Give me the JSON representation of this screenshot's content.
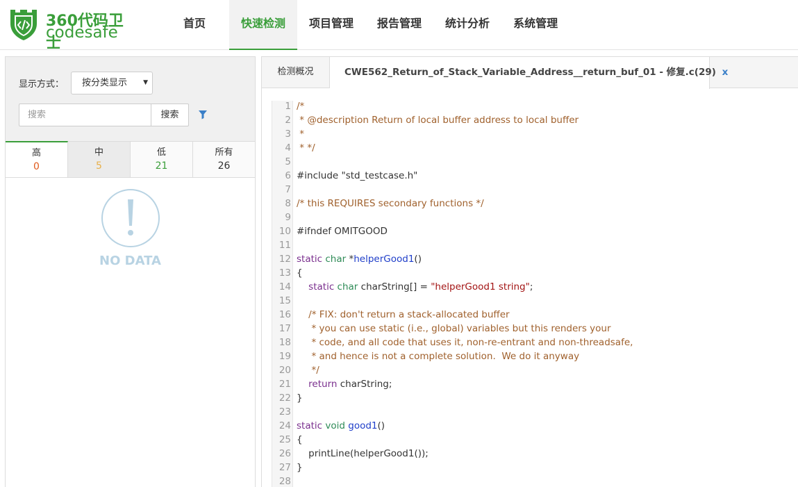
{
  "app": {
    "logo_cn": "360代码卫士",
    "logo_en": "codesafe",
    "colors": {
      "brand_green": "#3a9e3a",
      "link_blue": "#3a7fc8",
      "high": "#e05a1c",
      "medium": "#e8b04a",
      "low": "#3a9e3a"
    }
  },
  "nav": {
    "items": [
      {
        "label": "首页"
      },
      {
        "label": "快速检测"
      },
      {
        "label": "项目管理"
      },
      {
        "label": "报告管理"
      },
      {
        "label": "统计分析"
      },
      {
        "label": "系统管理"
      }
    ],
    "active": "快速检测"
  },
  "sidebar": {
    "display_label": "显示方式：",
    "display_value": "按分类显示",
    "search_placeholder": "搜索",
    "search_button": "搜索",
    "filter_icon": "filter-icon",
    "severity_tabs": [
      {
        "name": "高",
        "count": "0",
        "color": "#e05a1c"
      },
      {
        "name": "中",
        "count": "5",
        "color": "#e8b04a"
      },
      {
        "name": "低",
        "count": "21",
        "color": "#3a9e3a"
      },
      {
        "name": "所有",
        "count": "26",
        "color": "#333333"
      }
    ],
    "empty_icon": "exclamation-circle-icon",
    "empty_text": "NO DATA"
  },
  "tabs": {
    "overview_label": "检测概况",
    "file_label": "CWE562_Return_of_Stack_Variable_Address__return_buf_01 - 修复.c(29)",
    "close_label": "x"
  },
  "code": {
    "lines": [
      {
        "n": "1",
        "text": "/*",
        "kind": "comment"
      },
      {
        "n": "2",
        "text": " * @description Return of local buffer address to local buffer",
        "kind": "comment"
      },
      {
        "n": "3",
        "text": " *",
        "kind": "comment"
      },
      {
        "n": "4",
        "text": " * */",
        "kind": "comment"
      },
      {
        "n": "5",
        "text": "",
        "kind": "plain"
      },
      {
        "n": "6",
        "text": "#include \"std_testcase.h\"",
        "kind": "plain"
      },
      {
        "n": "7",
        "text": "",
        "kind": "plain"
      },
      {
        "n": "8",
        "text": "/* this REQUIRES secondary functions */",
        "kind": "comment"
      },
      {
        "n": "9",
        "text": "",
        "kind": "plain"
      },
      {
        "n": "10",
        "text": "#ifndef OMITGOOD",
        "kind": "plain"
      },
      {
        "n": "11",
        "text": "",
        "kind": "plain"
      },
      {
        "n": "12",
        "text": "static char *helperGood1()",
        "kind": "sig1"
      },
      {
        "n": "13",
        "text": "{",
        "kind": "plain"
      },
      {
        "n": "14",
        "text": "    static char charString[] = \"helperGood1 string\";",
        "kind": "decl"
      },
      {
        "n": "15",
        "text": "",
        "kind": "plain"
      },
      {
        "n": "16",
        "text": "    /* FIX: don't return a stack-allocated buffer",
        "kind": "comment"
      },
      {
        "n": "17",
        "text": "     * you can use static (i.e., global) variables but this renders your",
        "kind": "comment"
      },
      {
        "n": "18",
        "text": "     * code, and all code that uses it, non-re-entrant and non-threadsafe,",
        "kind": "comment"
      },
      {
        "n": "19",
        "text": "     * and hence is not a complete solution.  We do it anyway",
        "kind": "comment"
      },
      {
        "n": "20",
        "text": "     */",
        "kind": "comment"
      },
      {
        "n": "21",
        "text": "    return charString;",
        "kind": "ret"
      },
      {
        "n": "22",
        "text": "}",
        "kind": "plain"
      },
      {
        "n": "23",
        "text": "",
        "kind": "plain"
      },
      {
        "n": "24",
        "text": "static void good1()",
        "kind": "sig2"
      },
      {
        "n": "25",
        "text": "{",
        "kind": "plain"
      },
      {
        "n": "26",
        "text": "    printLine(helperGood1());",
        "kind": "plain"
      },
      {
        "n": "27",
        "text": "}",
        "kind": "plain"
      },
      {
        "n": "28",
        "text": "",
        "kind": "plain"
      }
    ]
  }
}
